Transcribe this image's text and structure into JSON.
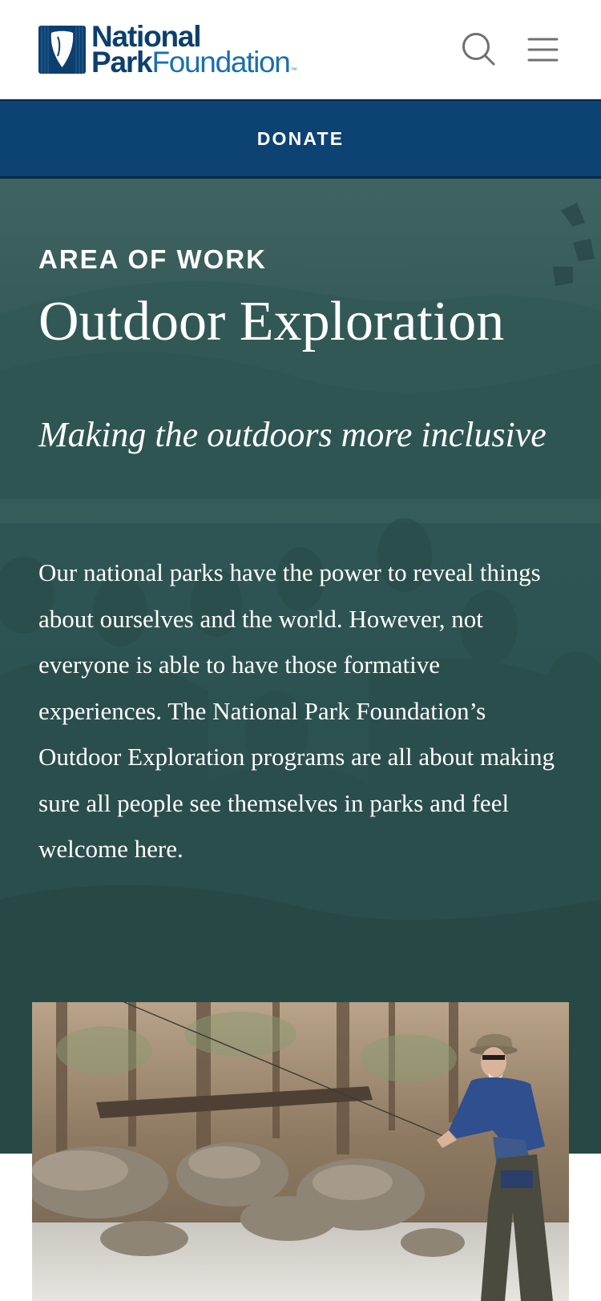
{
  "header": {
    "logo": {
      "line1": "National",
      "line2_bold": "Park",
      "line2_light": "Foundation",
      "trademark": "™"
    },
    "search_icon": "search-icon",
    "menu_icon": "hamburger-menu-icon"
  },
  "donate": {
    "label": "DONATE"
  },
  "hero": {
    "eyebrow": "AREA OF WORK",
    "title": "Outdoor Exploration",
    "tagline": "Making the outdoors more inclusive",
    "intro": "Our national parks have the power to reveal things about ourselves and the world. However, not everyone is able to have those formative experiences. The National Park Foundation’s Outdoor Exploration programs are all about making sure all people see themselves in parks and feel welcome here."
  },
  "colors": {
    "brand_navy": "#0c4373",
    "brand_blue": "#1a6fb0",
    "hero_teal": "#2e5654",
    "text_on_hero": "#ffffff"
  }
}
